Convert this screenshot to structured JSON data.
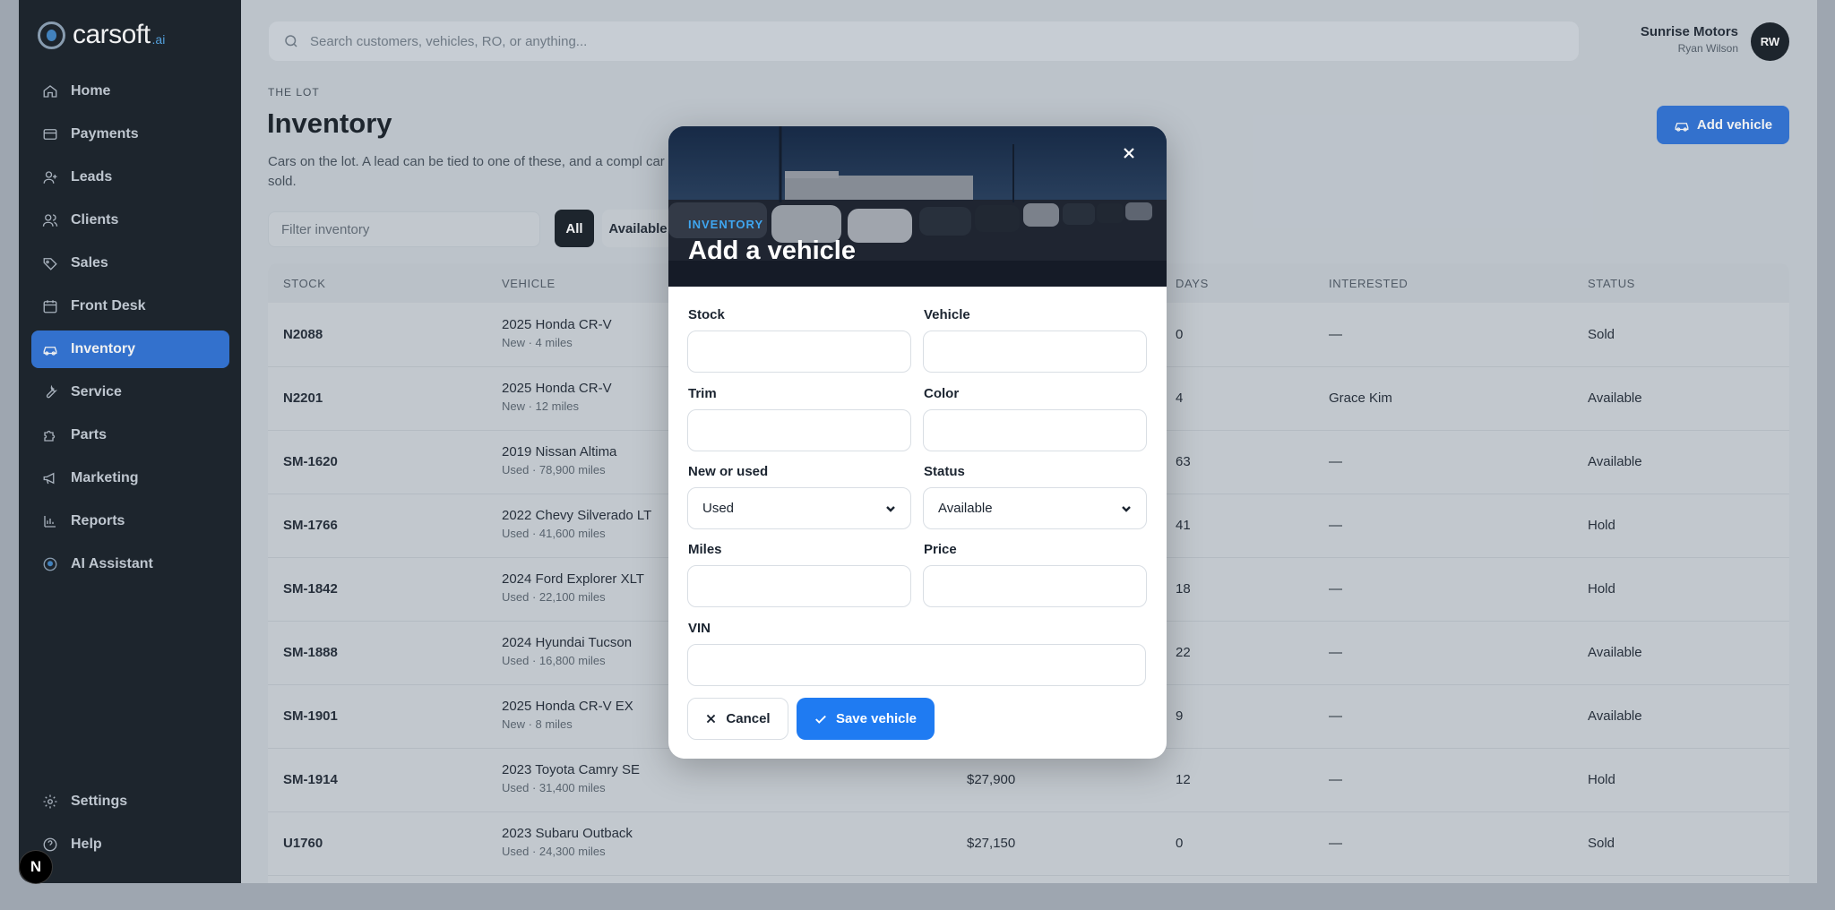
{
  "brand": {
    "name": "carsoft",
    "suffix": ".ai"
  },
  "sidebar": {
    "items": [
      {
        "label": "Home",
        "icon": "home-icon"
      },
      {
        "label": "Payments",
        "icon": "credit-card-icon"
      },
      {
        "label": "Leads",
        "icon": "user-plus-icon"
      },
      {
        "label": "Clients",
        "icon": "users-icon"
      },
      {
        "label": "Sales",
        "icon": "tag-icon"
      },
      {
        "label": "Front Desk",
        "icon": "calendar-icon"
      },
      {
        "label": "Inventory",
        "icon": "car-icon",
        "active": true
      },
      {
        "label": "Service",
        "icon": "wrench-icon"
      },
      {
        "label": "Parts",
        "icon": "puzzle-icon"
      },
      {
        "label": "Marketing",
        "icon": "megaphone-icon"
      },
      {
        "label": "Reports",
        "icon": "bar-chart-icon"
      },
      {
        "label": "AI Assistant",
        "icon": "ai-assistant-icon"
      }
    ],
    "bottom": [
      {
        "label": "Settings",
        "icon": "gear-icon"
      },
      {
        "label": "Help",
        "icon": "help-icon"
      }
    ]
  },
  "header": {
    "search_placeholder": "Search customers, vehicles, RO, or anything...",
    "dealer": "Sunrise Motors",
    "user": "Ryan Wilson",
    "initials": "RW"
  },
  "page": {
    "eyebrow": "THE LOT",
    "title": "Inventory",
    "description": "Cars on the lot. A lead can be tied to one of these, and a compl car sold.",
    "add_button": "Add vehicle",
    "filter_placeholder": "Filter inventory",
    "chips": [
      "All",
      "Available"
    ]
  },
  "table": {
    "columns": [
      "STOCK",
      "VEHICLE",
      "DAYS",
      "INTERESTED",
      "STATUS"
    ],
    "rows": [
      {
        "stock": "N2088",
        "vehicle": "2025 Honda CR-V",
        "detail": "New · 4 miles",
        "price": "",
        "days": "0",
        "interested": "—",
        "status": "Sold"
      },
      {
        "stock": "N2201",
        "vehicle": "2025 Honda CR-V",
        "detail": "New · 12 miles",
        "price": "",
        "days": "4",
        "interested": "Grace Kim",
        "status": "Available"
      },
      {
        "stock": "SM-1620",
        "vehicle": "2019 Nissan Altima",
        "detail": "Used · 78,900 miles",
        "price": "",
        "days": "63",
        "interested": "—",
        "status": "Available"
      },
      {
        "stock": "SM-1766",
        "vehicle": "2022 Chevy Silverado LT",
        "detail": "Used · 41,600 miles",
        "price": "",
        "days": "41",
        "interested": "—",
        "status": "Hold"
      },
      {
        "stock": "SM-1842",
        "vehicle": "2024 Ford Explorer XLT",
        "detail": "Used · 22,100 miles",
        "price": "",
        "days": "18",
        "interested": "—",
        "status": "Hold"
      },
      {
        "stock": "SM-1888",
        "vehicle": "2024 Hyundai Tucson",
        "detail": "Used · 16,800 miles",
        "price": "",
        "days": "22",
        "interested": "—",
        "status": "Available"
      },
      {
        "stock": "SM-1901",
        "vehicle": "2025 Honda CR-V EX",
        "detail": "New · 8 miles",
        "price": "",
        "days": "9",
        "interested": "—",
        "status": "Available"
      },
      {
        "stock": "SM-1914",
        "vehicle": "2023 Toyota Camry SE",
        "detail": "Used · 31,400 miles",
        "price": "$27,900",
        "days": "12",
        "interested": "—",
        "status": "Hold"
      },
      {
        "stock": "U1760",
        "vehicle": "2023 Subaru Outback",
        "detail": "Used · 24,300 miles",
        "price": "$27,150",
        "days": "0",
        "interested": "—",
        "status": "Sold"
      }
    ]
  },
  "modal": {
    "eyebrow": "INVENTORY",
    "title": "Add a vehicle",
    "fields": {
      "stock": {
        "label": "Stock",
        "value": ""
      },
      "vehicle": {
        "label": "Vehicle",
        "value": ""
      },
      "trim": {
        "label": "Trim",
        "value": ""
      },
      "color": {
        "label": "Color",
        "value": ""
      },
      "new_used": {
        "label": "New or used",
        "value": "Used"
      },
      "status": {
        "label": "Status",
        "value": "Available"
      },
      "miles": {
        "label": "Miles",
        "value": ""
      },
      "price": {
        "label": "Price",
        "value": ""
      },
      "vin": {
        "label": "VIN",
        "value": ""
      }
    },
    "cancel": "Cancel",
    "save": "Save vehicle"
  },
  "dev_badge": "N",
  "colors": {
    "accent": "#2a6fd6",
    "sidebar": "#111820",
    "save": "#1f7bf2",
    "hero_eyebrow": "#3fa6f0"
  }
}
